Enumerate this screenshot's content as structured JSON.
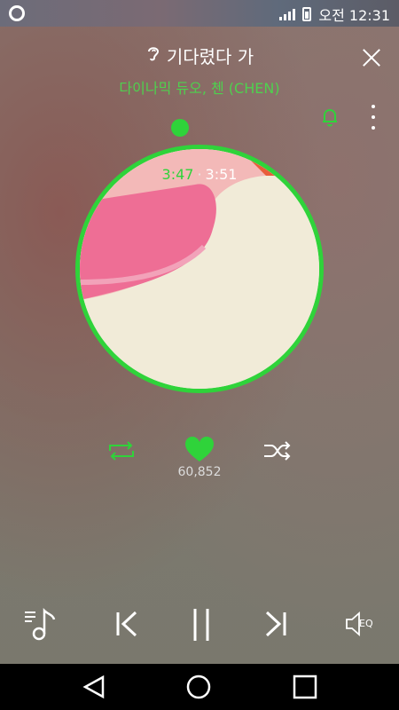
{
  "status_bar": {
    "time": "오전 12:31",
    "icons": [
      "sync-icon",
      "signal-icon",
      "battery-icon"
    ]
  },
  "player": {
    "song_title": "기다렸다 가",
    "artist": "다이나믹 듀오, 첸 (CHEN)",
    "time_elapsed": "3:47",
    "time_separator": "·",
    "time_total": "3:51",
    "like_count": "60,852",
    "eq_label": "EQ",
    "liked": true
  },
  "colors": {
    "accent": "#2fd33a",
    "artist_text": "#4ed14e",
    "background": "#7c7a6f",
    "nav_bar": "#000000"
  }
}
